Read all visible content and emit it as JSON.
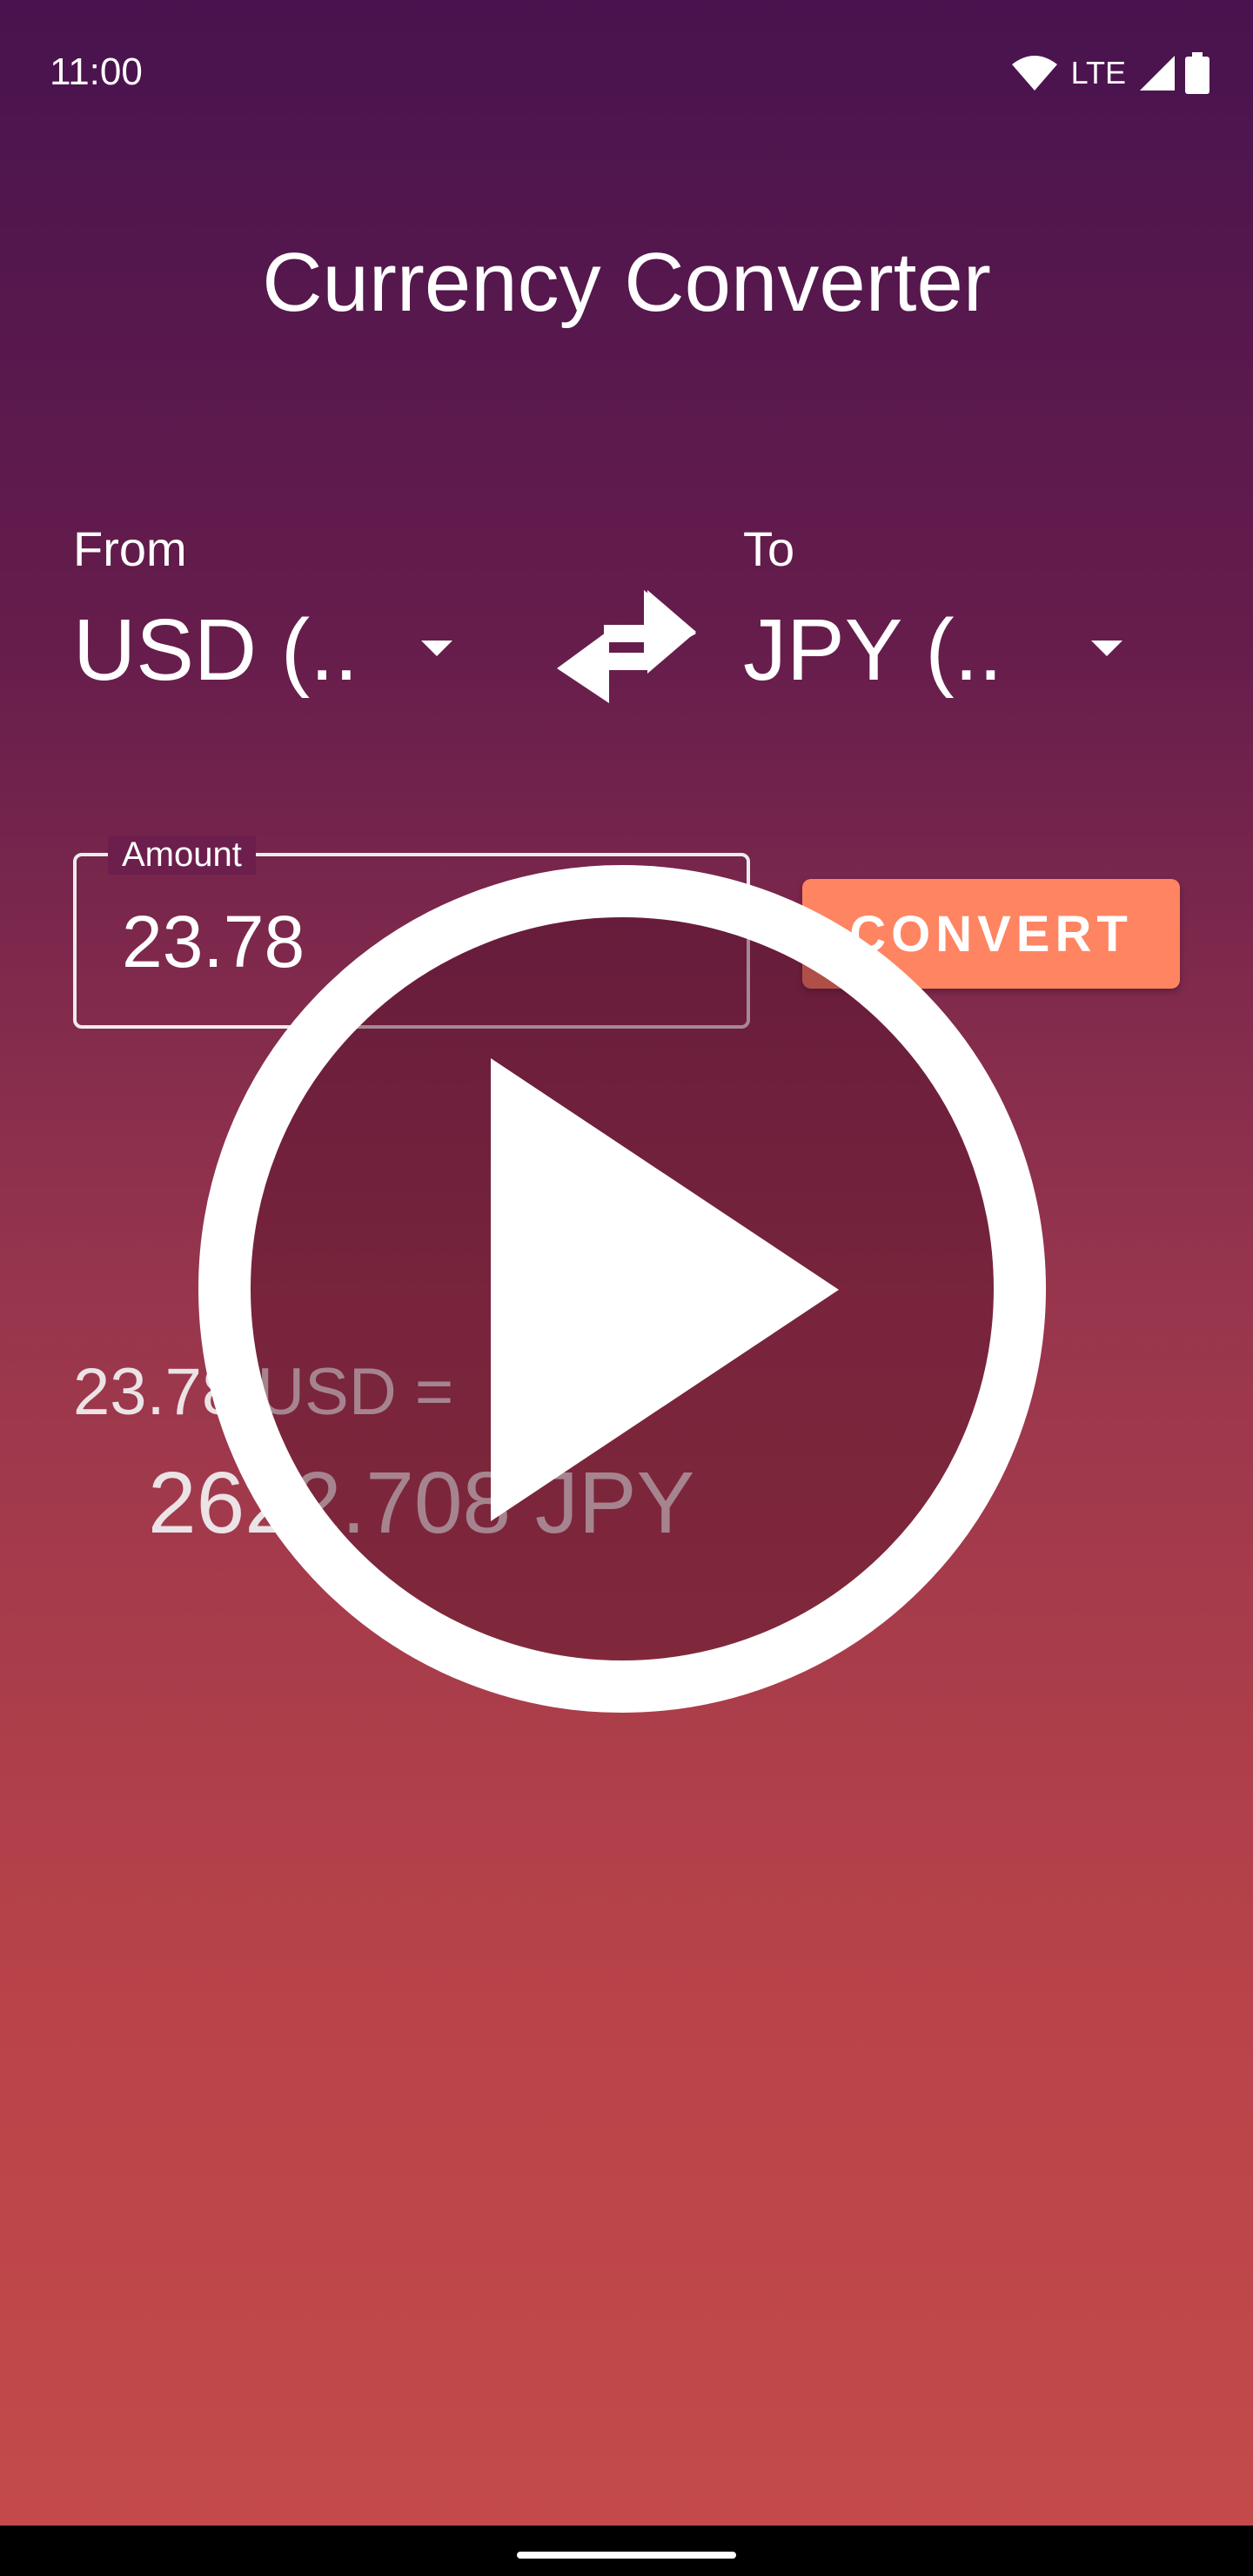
{
  "status_bar": {
    "time": "11:00",
    "network": "LTE",
    "icons": [
      "wifi-icon",
      "signal-icon",
      "battery-icon"
    ]
  },
  "app": {
    "title": "Currency Converter"
  },
  "from": {
    "label": "From",
    "value": "USD (.."
  },
  "to": {
    "label": "To",
    "value": "JPY (.."
  },
  "swap": {
    "icon": "swap-arrows-icon"
  },
  "amount": {
    "label": "Amount",
    "value": "23.78"
  },
  "convert": {
    "label": "CONVERT"
  },
  "result": {
    "line1": "23.78 USD =",
    "line2": "2622.708 JPY"
  },
  "overlay": {
    "icon": "play-icon"
  },
  "colors": {
    "background_top": "#48134e",
    "background_bottom": "#c54b4a",
    "button": "#ff8461",
    "text": "#ffffff"
  }
}
